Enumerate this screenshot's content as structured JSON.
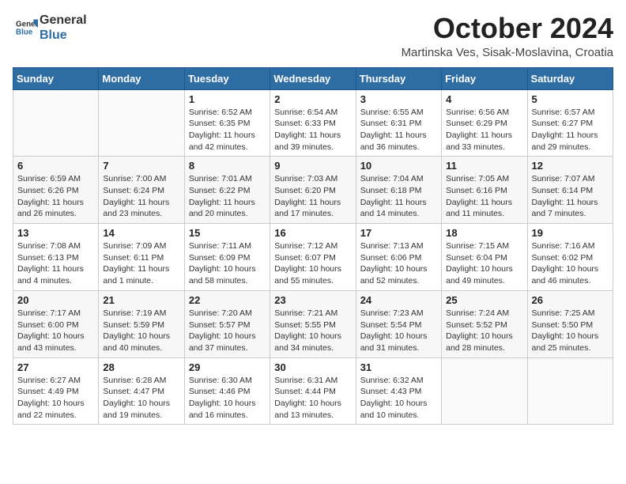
{
  "header": {
    "logo_general": "General",
    "logo_blue": "Blue",
    "month_title": "October 2024",
    "location": "Martinska Ves, Sisak-Moslavina, Croatia"
  },
  "weekdays": [
    "Sunday",
    "Monday",
    "Tuesday",
    "Wednesday",
    "Thursday",
    "Friday",
    "Saturday"
  ],
  "weeks": [
    [
      {
        "day": "",
        "info": ""
      },
      {
        "day": "",
        "info": ""
      },
      {
        "day": "1",
        "info": "Sunrise: 6:52 AM\nSunset: 6:35 PM\nDaylight: 11 hours and 42 minutes."
      },
      {
        "day": "2",
        "info": "Sunrise: 6:54 AM\nSunset: 6:33 PM\nDaylight: 11 hours and 39 minutes."
      },
      {
        "day": "3",
        "info": "Sunrise: 6:55 AM\nSunset: 6:31 PM\nDaylight: 11 hours and 36 minutes."
      },
      {
        "day": "4",
        "info": "Sunrise: 6:56 AM\nSunset: 6:29 PM\nDaylight: 11 hours and 33 minutes."
      },
      {
        "day": "5",
        "info": "Sunrise: 6:57 AM\nSunset: 6:27 PM\nDaylight: 11 hours and 29 minutes."
      }
    ],
    [
      {
        "day": "6",
        "info": "Sunrise: 6:59 AM\nSunset: 6:26 PM\nDaylight: 11 hours and 26 minutes."
      },
      {
        "day": "7",
        "info": "Sunrise: 7:00 AM\nSunset: 6:24 PM\nDaylight: 11 hours and 23 minutes."
      },
      {
        "day": "8",
        "info": "Sunrise: 7:01 AM\nSunset: 6:22 PM\nDaylight: 11 hours and 20 minutes."
      },
      {
        "day": "9",
        "info": "Sunrise: 7:03 AM\nSunset: 6:20 PM\nDaylight: 11 hours and 17 minutes."
      },
      {
        "day": "10",
        "info": "Sunrise: 7:04 AM\nSunset: 6:18 PM\nDaylight: 11 hours and 14 minutes."
      },
      {
        "day": "11",
        "info": "Sunrise: 7:05 AM\nSunset: 6:16 PM\nDaylight: 11 hours and 11 minutes."
      },
      {
        "day": "12",
        "info": "Sunrise: 7:07 AM\nSunset: 6:14 PM\nDaylight: 11 hours and 7 minutes."
      }
    ],
    [
      {
        "day": "13",
        "info": "Sunrise: 7:08 AM\nSunset: 6:13 PM\nDaylight: 11 hours and 4 minutes."
      },
      {
        "day": "14",
        "info": "Sunrise: 7:09 AM\nSunset: 6:11 PM\nDaylight: 11 hours and 1 minute."
      },
      {
        "day": "15",
        "info": "Sunrise: 7:11 AM\nSunset: 6:09 PM\nDaylight: 10 hours and 58 minutes."
      },
      {
        "day": "16",
        "info": "Sunrise: 7:12 AM\nSunset: 6:07 PM\nDaylight: 10 hours and 55 minutes."
      },
      {
        "day": "17",
        "info": "Sunrise: 7:13 AM\nSunset: 6:06 PM\nDaylight: 10 hours and 52 minutes."
      },
      {
        "day": "18",
        "info": "Sunrise: 7:15 AM\nSunset: 6:04 PM\nDaylight: 10 hours and 49 minutes."
      },
      {
        "day": "19",
        "info": "Sunrise: 7:16 AM\nSunset: 6:02 PM\nDaylight: 10 hours and 46 minutes."
      }
    ],
    [
      {
        "day": "20",
        "info": "Sunrise: 7:17 AM\nSunset: 6:00 PM\nDaylight: 10 hours and 43 minutes."
      },
      {
        "day": "21",
        "info": "Sunrise: 7:19 AM\nSunset: 5:59 PM\nDaylight: 10 hours and 40 minutes."
      },
      {
        "day": "22",
        "info": "Sunrise: 7:20 AM\nSunset: 5:57 PM\nDaylight: 10 hours and 37 minutes."
      },
      {
        "day": "23",
        "info": "Sunrise: 7:21 AM\nSunset: 5:55 PM\nDaylight: 10 hours and 34 minutes."
      },
      {
        "day": "24",
        "info": "Sunrise: 7:23 AM\nSunset: 5:54 PM\nDaylight: 10 hours and 31 minutes."
      },
      {
        "day": "25",
        "info": "Sunrise: 7:24 AM\nSunset: 5:52 PM\nDaylight: 10 hours and 28 minutes."
      },
      {
        "day": "26",
        "info": "Sunrise: 7:25 AM\nSunset: 5:50 PM\nDaylight: 10 hours and 25 minutes."
      }
    ],
    [
      {
        "day": "27",
        "info": "Sunrise: 6:27 AM\nSunset: 4:49 PM\nDaylight: 10 hours and 22 minutes."
      },
      {
        "day": "28",
        "info": "Sunrise: 6:28 AM\nSunset: 4:47 PM\nDaylight: 10 hours and 19 minutes."
      },
      {
        "day": "29",
        "info": "Sunrise: 6:30 AM\nSunset: 4:46 PM\nDaylight: 10 hours and 16 minutes."
      },
      {
        "day": "30",
        "info": "Sunrise: 6:31 AM\nSunset: 4:44 PM\nDaylight: 10 hours and 13 minutes."
      },
      {
        "day": "31",
        "info": "Sunrise: 6:32 AM\nSunset: 4:43 PM\nDaylight: 10 hours and 10 minutes."
      },
      {
        "day": "",
        "info": ""
      },
      {
        "day": "",
        "info": ""
      }
    ]
  ]
}
